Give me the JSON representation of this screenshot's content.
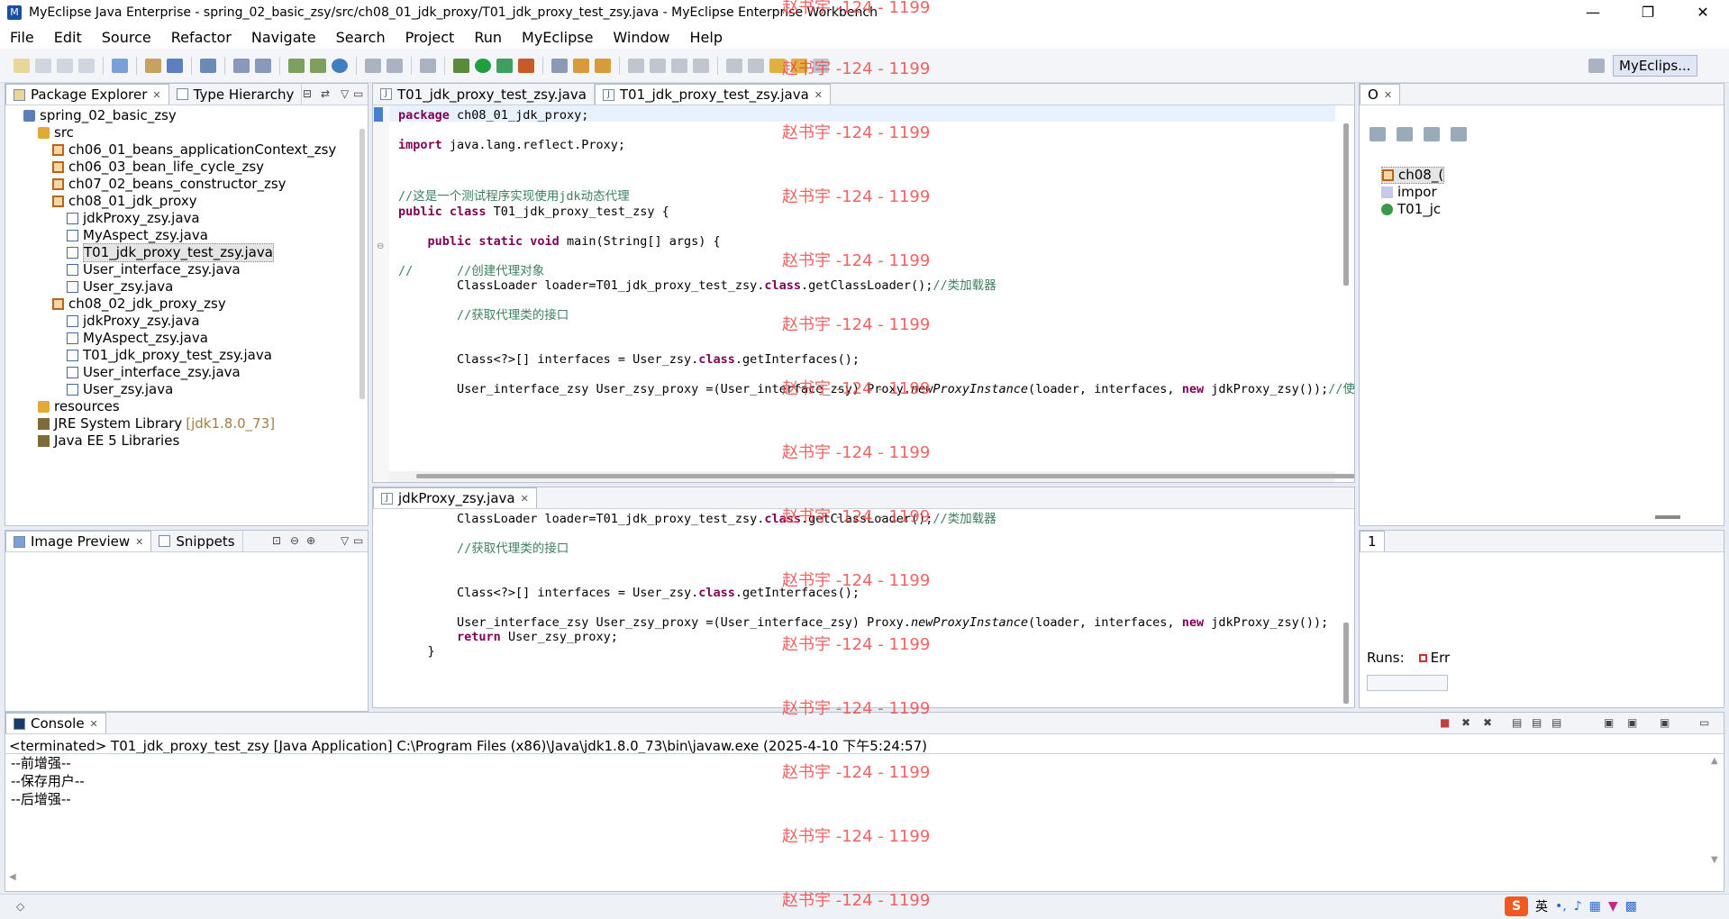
{
  "window": {
    "title": "MyEclipse Java Enterprise - spring_02_basic_zsy/src/ch08_01_jdk_proxy/T01_jdk_proxy_test_zsy.java - MyEclipse Enterprise Workbench",
    "minimize": "—",
    "maximize": "❐",
    "close": "✕"
  },
  "menu": [
    "File",
    "Edit",
    "Source",
    "Refactor",
    "Navigate",
    "Search",
    "Project",
    "Run",
    "MyEclipse",
    "Window",
    "Help"
  ],
  "perspective": "MyEclips...",
  "package_explorer": {
    "tab1": "Package Explorer",
    "tab2": "Type Hierarchy",
    "items": [
      {
        "label": "spring_02_basic_zsy",
        "icon": "project-icon",
        "level": 0
      },
      {
        "label": "src",
        "icon": "source-folder-icon",
        "level": 1
      },
      {
        "label": "ch06_01_beans_applicationContext_zsy",
        "icon": "package-icon",
        "level": 2
      },
      {
        "label": "ch06_03_bean_life_cycle_zsy",
        "icon": "package-icon",
        "level": 2
      },
      {
        "label": "ch07_02_beans_constructor_zsy",
        "icon": "package-icon",
        "level": 2
      },
      {
        "label": "ch08_01_jdk_proxy",
        "icon": "package-icon",
        "level": 2
      },
      {
        "label": "jdkProxy_zsy.java",
        "icon": "java-file-icon",
        "level": 3
      },
      {
        "label": "MyAspect_zsy.java",
        "icon": "java-file-icon",
        "level": 3
      },
      {
        "label": "T01_jdk_proxy_test_zsy.java",
        "icon": "java-file-icon",
        "level": 3,
        "selected": true
      },
      {
        "label": "User_interface_zsy.java",
        "icon": "java-file-icon",
        "level": 3
      },
      {
        "label": "User_zsy.java",
        "icon": "java-file-icon",
        "level": 3
      },
      {
        "label": "ch08_02_jdk_proxy_zsy",
        "icon": "package-icon",
        "level": 2
      },
      {
        "label": "jdkProxy_zsy.java",
        "icon": "java-file-icon",
        "level": 3
      },
      {
        "label": "MyAspect_zsy.java",
        "icon": "java-file-icon",
        "level": 3
      },
      {
        "label": "T01_jdk_proxy_test_zsy.java",
        "icon": "java-file-icon",
        "level": 3
      },
      {
        "label": "User_interface_zsy.java",
        "icon": "java-file-icon",
        "level": 3
      },
      {
        "label": "User_zsy.java",
        "icon": "java-file-icon",
        "level": 3
      },
      {
        "label": "resources",
        "icon": "folder-icon",
        "level": 1
      },
      {
        "label": "JRE System Library",
        "suffix": "[jdk1.8.0_73]",
        "icon": "library-icon",
        "level": 1
      },
      {
        "label": "Java EE 5 Libraries",
        "icon": "library-icon",
        "level": 1
      }
    ]
  },
  "image_preview": {
    "tab1": "Image Preview",
    "tab2": "Snippets"
  },
  "editor_top": {
    "tab1": "T01_jdk_proxy_test_zsy.java",
    "tab2": "T01_jdk_proxy_test_zsy.java",
    "lines": [
      "package ch08_01_jdk_proxy;",
      "import java.lang.reflect.Proxy;",
      "//这是一个测试程序实现使用jdk动态代理",
      "public class T01_jdk_proxy_test_zsy {",
      "    public static void main(String[] args) {",
      "//      //创建代理对象",
      "        ClassLoader loader=T01_jdk_proxy_test_zsy.class.getClassLoader();//类加载器",
      "        //获取代理类的接口",
      "        Class<?>[] interfaces = User_zsy.class.getInterfaces();",
      "        User_interface_zsy User_zsy_proxy =(User_interface_zsy) Proxy.newProxyInstance(loader, interfaces, new jdkProxy_zsy());//使用pro"
    ]
  },
  "editor_bottom": {
    "tab": "jdkProxy_zsy.java",
    "lines": [
      "        ClassLoader loader=T01_jdk_proxy_test_zsy.class.getClassLoader();//类加载器",
      "        //获取代理类的接口",
      "        Class<?>[] interfaces = User_zsy.class.getInterfaces();",
      "        User_interface_zsy User_zsy_proxy =(User_interface_zsy) Proxy.newProxyInstance(loader, interfaces, new jdkProxy_zsy());",
      "        return User_zsy_proxy;",
      "    }"
    ]
  },
  "outline": {
    "tab": "O",
    "items": [
      "ch08_(",
      "impor",
      "T01_jc"
    ]
  },
  "junit": {
    "tab": "1",
    "runs_label": "Runs:",
    "err_label": "Err"
  },
  "console": {
    "tab": "Console",
    "status": "<terminated> T01_jdk_proxy_test_zsy [Java Application] C:\\Program Files (x86)\\Java\\jdk1.8.0_73\\bin\\javaw.exe (2025-4-10 下午5:24:57)",
    "output": [
      "--前增强--",
      "--保存用户--",
      "--后增强--"
    ]
  },
  "ime": {
    "lang": "英"
  },
  "watermark": "赵书宇 -124 - 1199"
}
